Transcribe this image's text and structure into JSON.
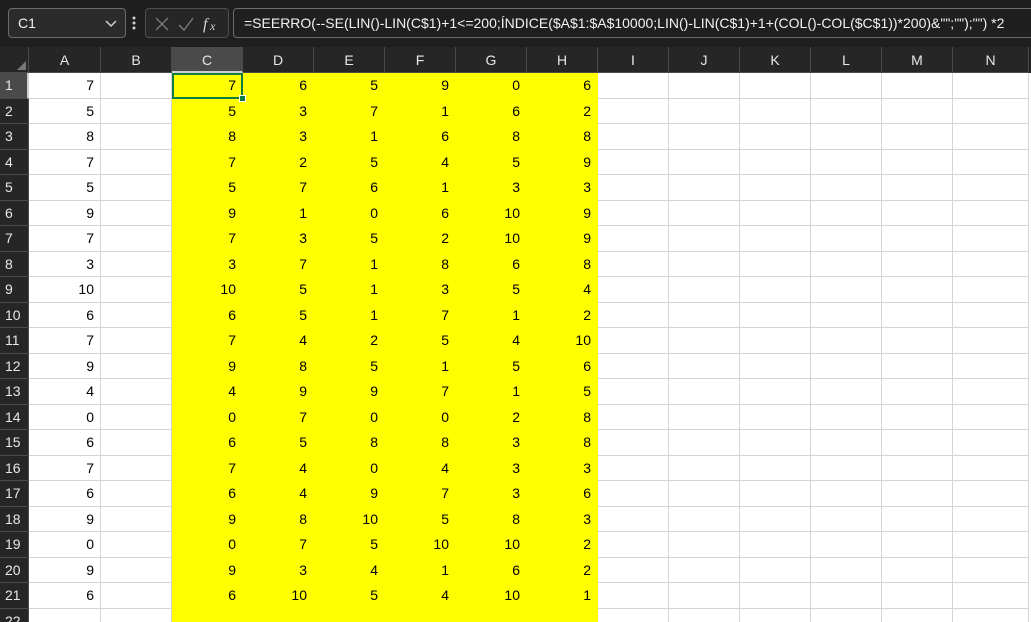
{
  "name_box": {
    "value": "C1"
  },
  "formula_bar": {
    "formula": "=SEERRO(--SE(LIN()-LIN(C$1)+1<=200;ÍNDICE($A$1:$A$10000;LIN()-LIN(C$1)+1+(COL()-COL($C$1))*200)&\"\";\"\");\"\")  *2"
  },
  "icons": {
    "name_box_dropdown": "chevron-down-icon",
    "more": "vertical-dots-icon",
    "cancel": "close-icon",
    "enter": "check-icon",
    "function": "fx-icon"
  },
  "colors": {
    "highlight": "#ffff00",
    "active_border": "#107c41"
  },
  "columns": [
    "A",
    "B",
    "C",
    "D",
    "E",
    "F",
    "G",
    "H",
    "I",
    "J",
    "K",
    "L",
    "M",
    "N"
  ],
  "selected_column": "C",
  "selected_row": "1",
  "rows": [
    {
      "r": "1",
      "cells": [
        "7",
        "",
        "7",
        "6",
        "5",
        "9",
        "0",
        "6",
        "",
        "",
        "",
        "",
        "",
        ""
      ]
    },
    {
      "r": "2",
      "cells": [
        "5",
        "",
        "5",
        "3",
        "7",
        "1",
        "6",
        "2",
        "",
        "",
        "",
        "",
        "",
        ""
      ]
    },
    {
      "r": "3",
      "cells": [
        "8",
        "",
        "8",
        "3",
        "1",
        "6",
        "8",
        "8",
        "",
        "",
        "",
        "",
        "",
        ""
      ]
    },
    {
      "r": "4",
      "cells": [
        "7",
        "",
        "7",
        "2",
        "5",
        "4",
        "5",
        "9",
        "",
        "",
        "",
        "",
        "",
        ""
      ]
    },
    {
      "r": "5",
      "cells": [
        "5",
        "",
        "5",
        "7",
        "6",
        "1",
        "3",
        "3",
        "",
        "",
        "",
        "",
        "",
        ""
      ]
    },
    {
      "r": "6",
      "cells": [
        "9",
        "",
        "9",
        "1",
        "0",
        "6",
        "10",
        "9",
        "",
        "",
        "",
        "",
        "",
        ""
      ]
    },
    {
      "r": "7",
      "cells": [
        "7",
        "",
        "7",
        "3",
        "5",
        "2",
        "10",
        "9",
        "",
        "",
        "",
        "",
        "",
        ""
      ]
    },
    {
      "r": "8",
      "cells": [
        "3",
        "",
        "3",
        "7",
        "1",
        "8",
        "6",
        "8",
        "",
        "",
        "",
        "",
        "",
        ""
      ]
    },
    {
      "r": "9",
      "cells": [
        "10",
        "",
        "10",
        "5",
        "1",
        "3",
        "5",
        "4",
        "",
        "",
        "",
        "",
        "",
        ""
      ]
    },
    {
      "r": "10",
      "cells": [
        "6",
        "",
        "6",
        "5",
        "1",
        "7",
        "1",
        "2",
        "",
        "",
        "",
        "",
        "",
        ""
      ]
    },
    {
      "r": "11",
      "cells": [
        "7",
        "",
        "7",
        "4",
        "2",
        "5",
        "4",
        "10",
        "",
        "",
        "",
        "",
        "",
        ""
      ]
    },
    {
      "r": "12",
      "cells": [
        "9",
        "",
        "9",
        "8",
        "5",
        "1",
        "5",
        "6",
        "",
        "",
        "",
        "",
        "",
        ""
      ]
    },
    {
      "r": "13",
      "cells": [
        "4",
        "",
        "4",
        "9",
        "9",
        "7",
        "1",
        "5",
        "",
        "",
        "",
        "",
        "",
        ""
      ]
    },
    {
      "r": "14",
      "cells": [
        "0",
        "",
        "0",
        "7",
        "0",
        "0",
        "2",
        "8",
        "",
        "",
        "",
        "",
        "",
        ""
      ]
    },
    {
      "r": "15",
      "cells": [
        "6",
        "",
        "6",
        "5",
        "8",
        "8",
        "3",
        "8",
        "",
        "",
        "",
        "",
        "",
        ""
      ]
    },
    {
      "r": "16",
      "cells": [
        "7",
        "",
        "7",
        "4",
        "0",
        "4",
        "3",
        "3",
        "",
        "",
        "",
        "",
        "",
        ""
      ]
    },
    {
      "r": "17",
      "cells": [
        "6",
        "",
        "6",
        "4",
        "9",
        "7",
        "3",
        "6",
        "",
        "",
        "",
        "",
        "",
        ""
      ]
    },
    {
      "r": "18",
      "cells": [
        "9",
        "",
        "9",
        "8",
        "10",
        "5",
        "8",
        "3",
        "",
        "",
        "",
        "",
        "",
        ""
      ]
    },
    {
      "r": "19",
      "cells": [
        "0",
        "",
        "0",
        "7",
        "5",
        "10",
        "10",
        "2",
        "",
        "",
        "",
        "",
        "",
        ""
      ]
    },
    {
      "r": "20",
      "cells": [
        "9",
        "",
        "9",
        "3",
        "4",
        "1",
        "6",
        "2",
        "",
        "",
        "",
        "",
        "",
        ""
      ]
    },
    {
      "r": "21",
      "cells": [
        "6",
        "",
        "6",
        "10",
        "5",
        "4",
        "10",
        "1",
        "",
        "",
        "",
        "",
        "",
        ""
      ]
    },
    {
      "r": "22",
      "cells": [
        "",
        "",
        "",
        "",
        "",
        "",
        "",
        "",
        "",
        "",
        "",
        "",
        "",
        ""
      ]
    }
  ]
}
